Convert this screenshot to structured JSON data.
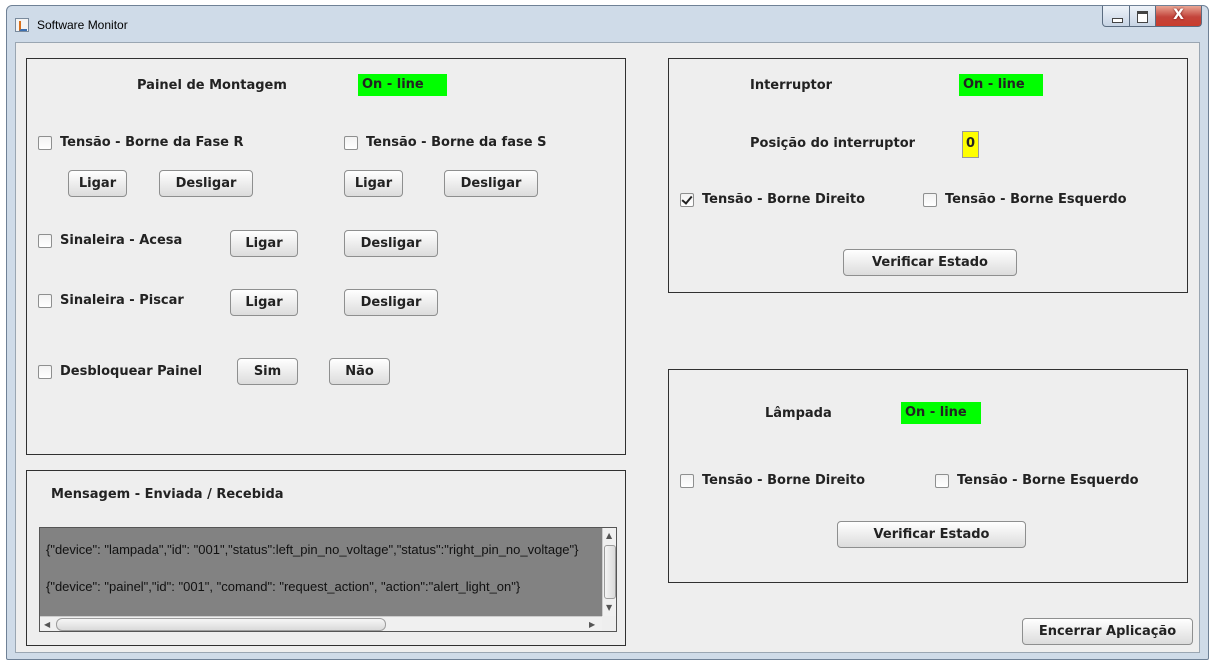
{
  "window": {
    "title": "Software Monitor",
    "close_glyph": "X"
  },
  "painel": {
    "title": "Painel de Montagem",
    "status": "On - line",
    "fase_r": {
      "label": "Tensão - Borne da Fase R",
      "checked": false
    },
    "fase_s": {
      "label": "Tensão - Borne da fase S",
      "checked": false
    },
    "ligar_label": "Ligar",
    "desligar_label": "Desligar",
    "sinaleira_acesa": {
      "label": "Sinaleira  - Acesa",
      "checked": false
    },
    "sinaleira_piscar": {
      "label": "Sinaleira - Piscar",
      "checked": false
    },
    "desbloquear": {
      "label": "Desbloquear Painel",
      "checked": false
    },
    "sim_label": "Sim",
    "nao_label": "Não"
  },
  "mensagem": {
    "title": "Mensagem - Enviada / Recebida",
    "lines": [
      "{\"device\": \"lampada\",\"id\": \"001\",\"status\":left_pin_no_voltage\",\"status\":\"right_pin_no_voltage\"}",
      "{\"device\": \"painel\",\"id\": \"001\", \"comand\": \"request_action\", \"action\":\"alert_light_on\"}"
    ]
  },
  "interruptor": {
    "title": "Interruptor",
    "status": "On - line",
    "posicao_label": "Posição do interruptor",
    "posicao_value": "0",
    "borne_direito": {
      "label": "Tensão - Borne Direito",
      "checked": true
    },
    "borne_esquerdo": {
      "label": "Tensão - Borne Esquerdo",
      "checked": false
    },
    "verificar_label": "Verificar Estado"
  },
  "lampada": {
    "title": "Lâmpada",
    "status": "On - line",
    "borne_direito": {
      "label": "Tensão - Borne Direito",
      "checked": false
    },
    "borne_esquerdo": {
      "label": "Tensão - Borne Esquerdo",
      "checked": false
    },
    "verificar_label": "Verificar Estado"
  },
  "encerrar_label": "Encerrar Aplicação",
  "colors": {
    "online": "#00ff00",
    "position": "#ffff00",
    "message_bg": "#828282"
  }
}
